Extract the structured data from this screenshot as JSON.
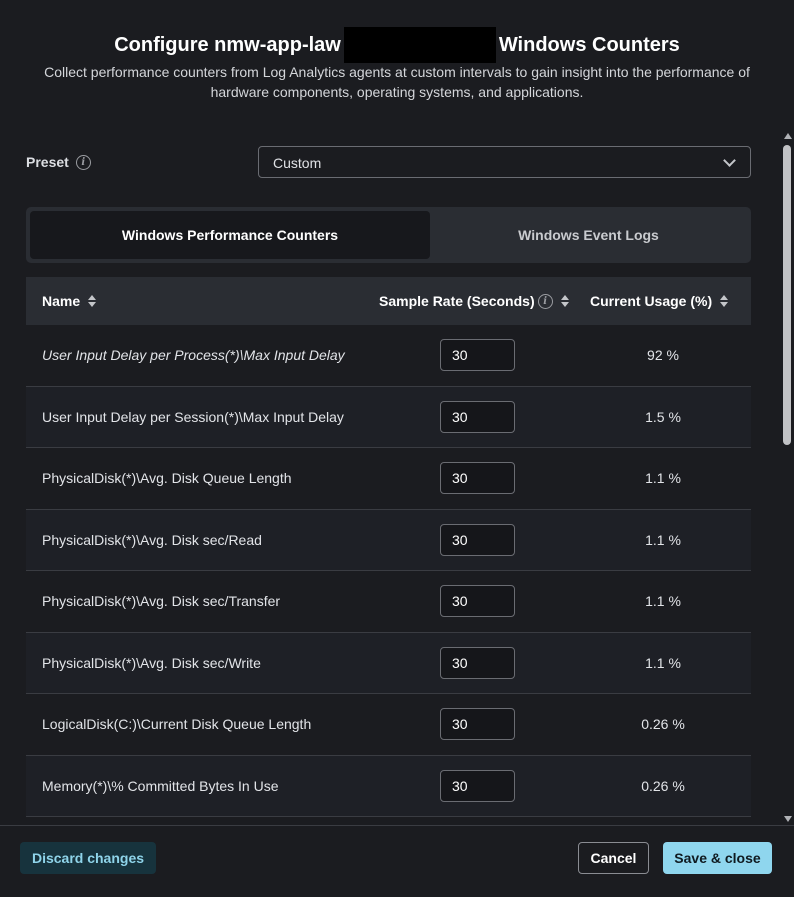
{
  "dialog": {
    "title_prefix": "Configure nmw-app-law",
    "title_suffix": "Windows Counters",
    "subtitle": "Collect performance counters from Log Analytics agents at custom intervals to gain insight into the performance of hardware components, operating systems, and applications."
  },
  "preset": {
    "label": "Preset",
    "value": "Custom"
  },
  "tabs": [
    {
      "label": "Windows Performance Counters",
      "active": true
    },
    {
      "label": "Windows Event Logs",
      "active": false
    }
  ],
  "table": {
    "headers": {
      "name": "Name",
      "sample_rate": "Sample Rate (Seconds)",
      "current_usage": "Current Usage (%)"
    },
    "rows": [
      {
        "name": "User Input Delay per Process(*)\\Max Input Delay",
        "rate": "30",
        "usage": "92 %"
      },
      {
        "name": "User Input Delay per Session(*)\\Max Input Delay",
        "rate": "30",
        "usage": "1.5 %"
      },
      {
        "name": "PhysicalDisk(*)\\Avg. Disk Queue Length",
        "rate": "30",
        "usage": "1.1 %"
      },
      {
        "name": "PhysicalDisk(*)\\Avg. Disk sec/Read",
        "rate": "30",
        "usage": "1.1 %"
      },
      {
        "name": "PhysicalDisk(*)\\Avg. Disk sec/Transfer",
        "rate": "30",
        "usage": "1.1 %"
      },
      {
        "name": "PhysicalDisk(*)\\Avg. Disk sec/Write",
        "rate": "30",
        "usage": "1.1 %"
      },
      {
        "name": "LogicalDisk(C:)\\Current Disk Queue Length",
        "rate": "30",
        "usage": "0.26 %"
      },
      {
        "name": "Memory(*)\\% Committed Bytes In Use",
        "rate": "30",
        "usage": "0.26 %"
      }
    ]
  },
  "footer": {
    "discard_label": "Discard changes",
    "cancel_label": "Cancel",
    "save_label": "Save & close"
  },
  "icons": {
    "info": "info-icon",
    "chevron": "chevron-down-icon",
    "sort": "sort-icon"
  },
  "colors": {
    "background": "#1b1c20",
    "accent": "#8fd6ee",
    "discard_bg": "#17333d"
  }
}
